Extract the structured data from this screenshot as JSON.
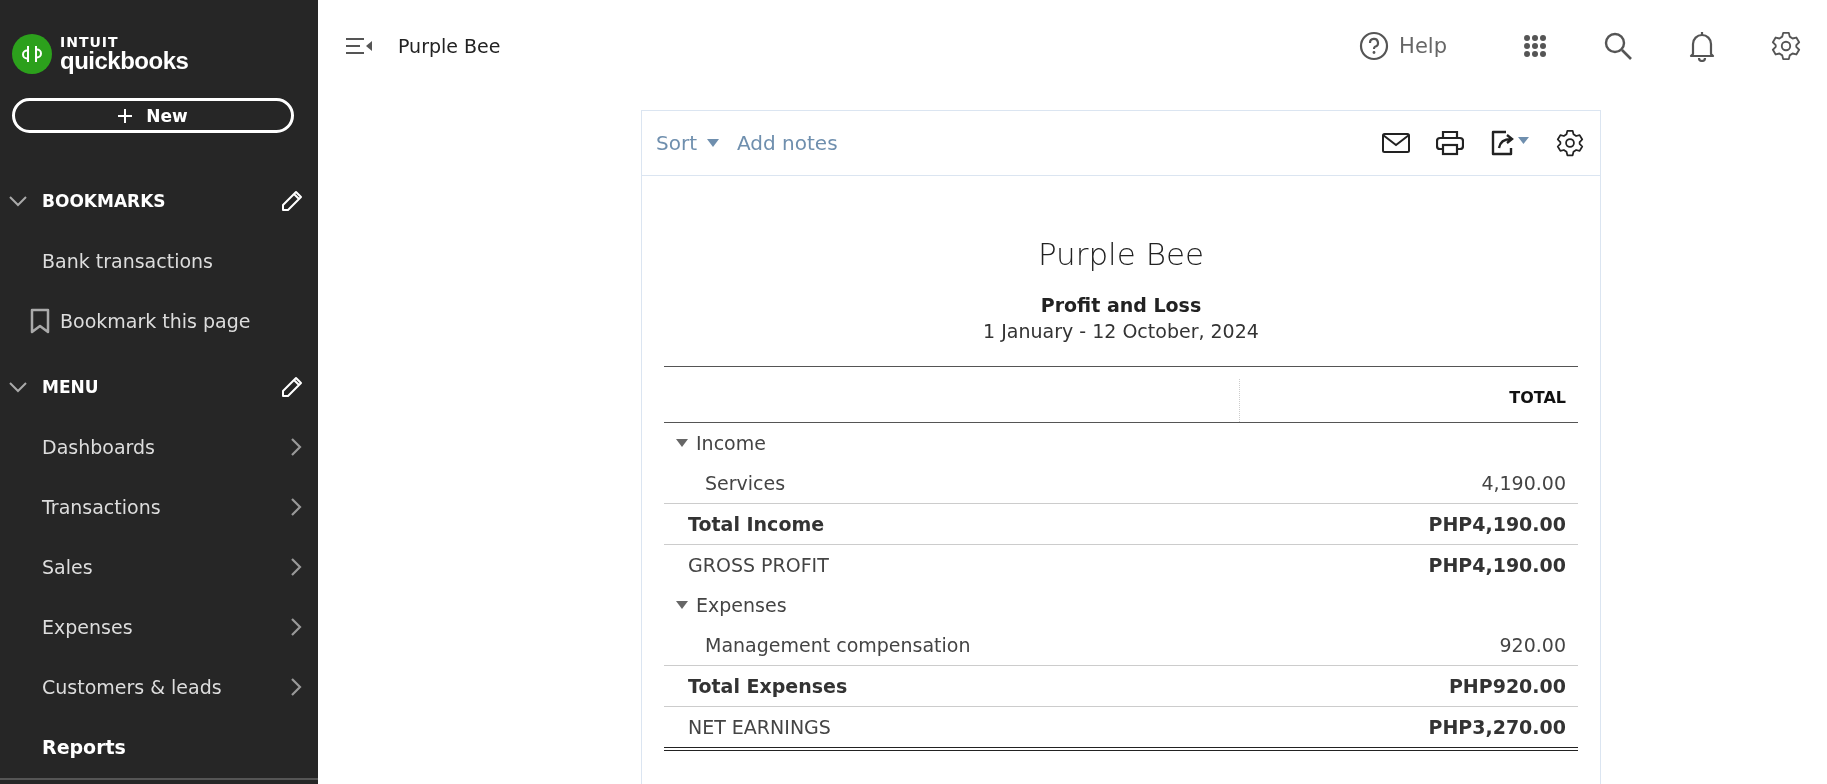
{
  "sidebar": {
    "brand_top": "INTUIT",
    "brand": "quickbooks",
    "new_button": "New",
    "sections": [
      {
        "title": "BOOKMARKS",
        "expanded": true,
        "items": [
          {
            "label": "Bank transactions",
            "kind": "link",
            "selected": false
          },
          {
            "label": "Bookmark this page",
            "kind": "bookmark",
            "selected": false
          }
        ]
      },
      {
        "title": "MENU",
        "expanded": true,
        "items": [
          {
            "label": "Dashboards",
            "kind": "submenu",
            "selected": false
          },
          {
            "label": "Transactions",
            "kind": "submenu",
            "selected": false
          },
          {
            "label": "Sales",
            "kind": "submenu",
            "selected": false
          },
          {
            "label": "Expenses",
            "kind": "submenu",
            "selected": false
          },
          {
            "label": "Customers & leads",
            "kind": "submenu",
            "selected": false
          },
          {
            "label": "Reports",
            "kind": "link",
            "selected": true
          }
        ]
      }
    ]
  },
  "topbar": {
    "company": "Purple Bee",
    "help": "Help"
  },
  "report": {
    "toolbar": {
      "sort": "Sort",
      "notes": "Add notes"
    },
    "company": "Purple Bee",
    "title": "Profit and Loss",
    "period": "1 January - 12 October, 2024",
    "columns": [
      "TOTAL"
    ],
    "rows": [
      {
        "kind": "section",
        "label": "Income",
        "expanded": true,
        "amount": ""
      },
      {
        "kind": "item",
        "label": "Services",
        "amount": "4,190.00"
      },
      {
        "kind": "total",
        "label": "Total Income",
        "amount": "PHP4,190.00"
      },
      {
        "kind": "summary",
        "label": "GROSS PROFIT",
        "amount": "PHP4,190.00"
      },
      {
        "kind": "section",
        "label": "Expenses",
        "expanded": true,
        "amount": ""
      },
      {
        "kind": "item",
        "label": "Management compensation",
        "amount": "920.00"
      },
      {
        "kind": "total",
        "label": "Total Expenses",
        "amount": "PHP920.00"
      },
      {
        "kind": "final",
        "label": "NET EARNINGS",
        "amount": "PHP3,270.00"
      }
    ]
  }
}
